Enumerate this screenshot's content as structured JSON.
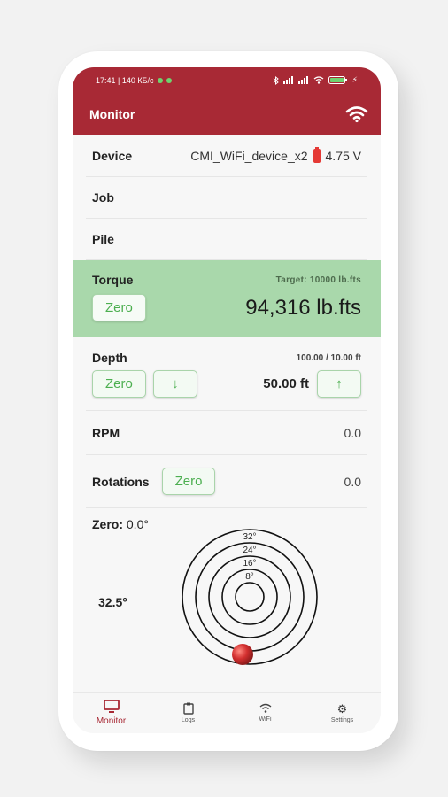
{
  "status_bar": {
    "time_speed": "17:41 | 140 КБ/с",
    "battery_level": "full"
  },
  "app_bar": {
    "title": "Monitor",
    "wifi_icon": "wifi-icon"
  },
  "device": {
    "label": "Device",
    "name": "CMI_WiFi_device_x2",
    "battery_icon": "battery-icon",
    "voltage": "4.75 V"
  },
  "job": {
    "label": "Job",
    "value": ""
  },
  "pile": {
    "label": "Pile",
    "value": ""
  },
  "torque": {
    "label": "Torque",
    "target": "Target: 10000 lb.fts",
    "zero_label": "Zero",
    "value": "94,316 lb.fts",
    "highlight_color": "#a9d8ab"
  },
  "depth": {
    "label": "Depth",
    "range": "100.00 / 10.00 ft",
    "zero_label": "Zero",
    "down_icon": "↓",
    "value": "50.00 ft",
    "up_icon": "↑"
  },
  "rpm": {
    "label": "RPM",
    "value": "0.0"
  },
  "rotations": {
    "label": "Rotations",
    "zero_label": "Zero",
    "value": "0.0"
  },
  "inclinometer": {
    "zero_prefix": "Zero:",
    "zero_value": "0.0°",
    "angle": "32.5°",
    "rings": [
      "32°",
      "24°",
      "16°",
      "8°"
    ],
    "ball_color": "#d32f2f"
  },
  "nav": {
    "items": [
      {
        "label": "Monitor",
        "icon": "monitor-icon",
        "active": true
      },
      {
        "label": "Logs",
        "icon": "clipboard-icon",
        "active": false
      },
      {
        "label": "WiFi",
        "icon": "wifi-icon",
        "active": false
      },
      {
        "label": "Settings",
        "icon": "gear-icon",
        "active": false
      }
    ]
  },
  "colors": {
    "brand": "#a82935",
    "accent_green": "#4caf50"
  }
}
